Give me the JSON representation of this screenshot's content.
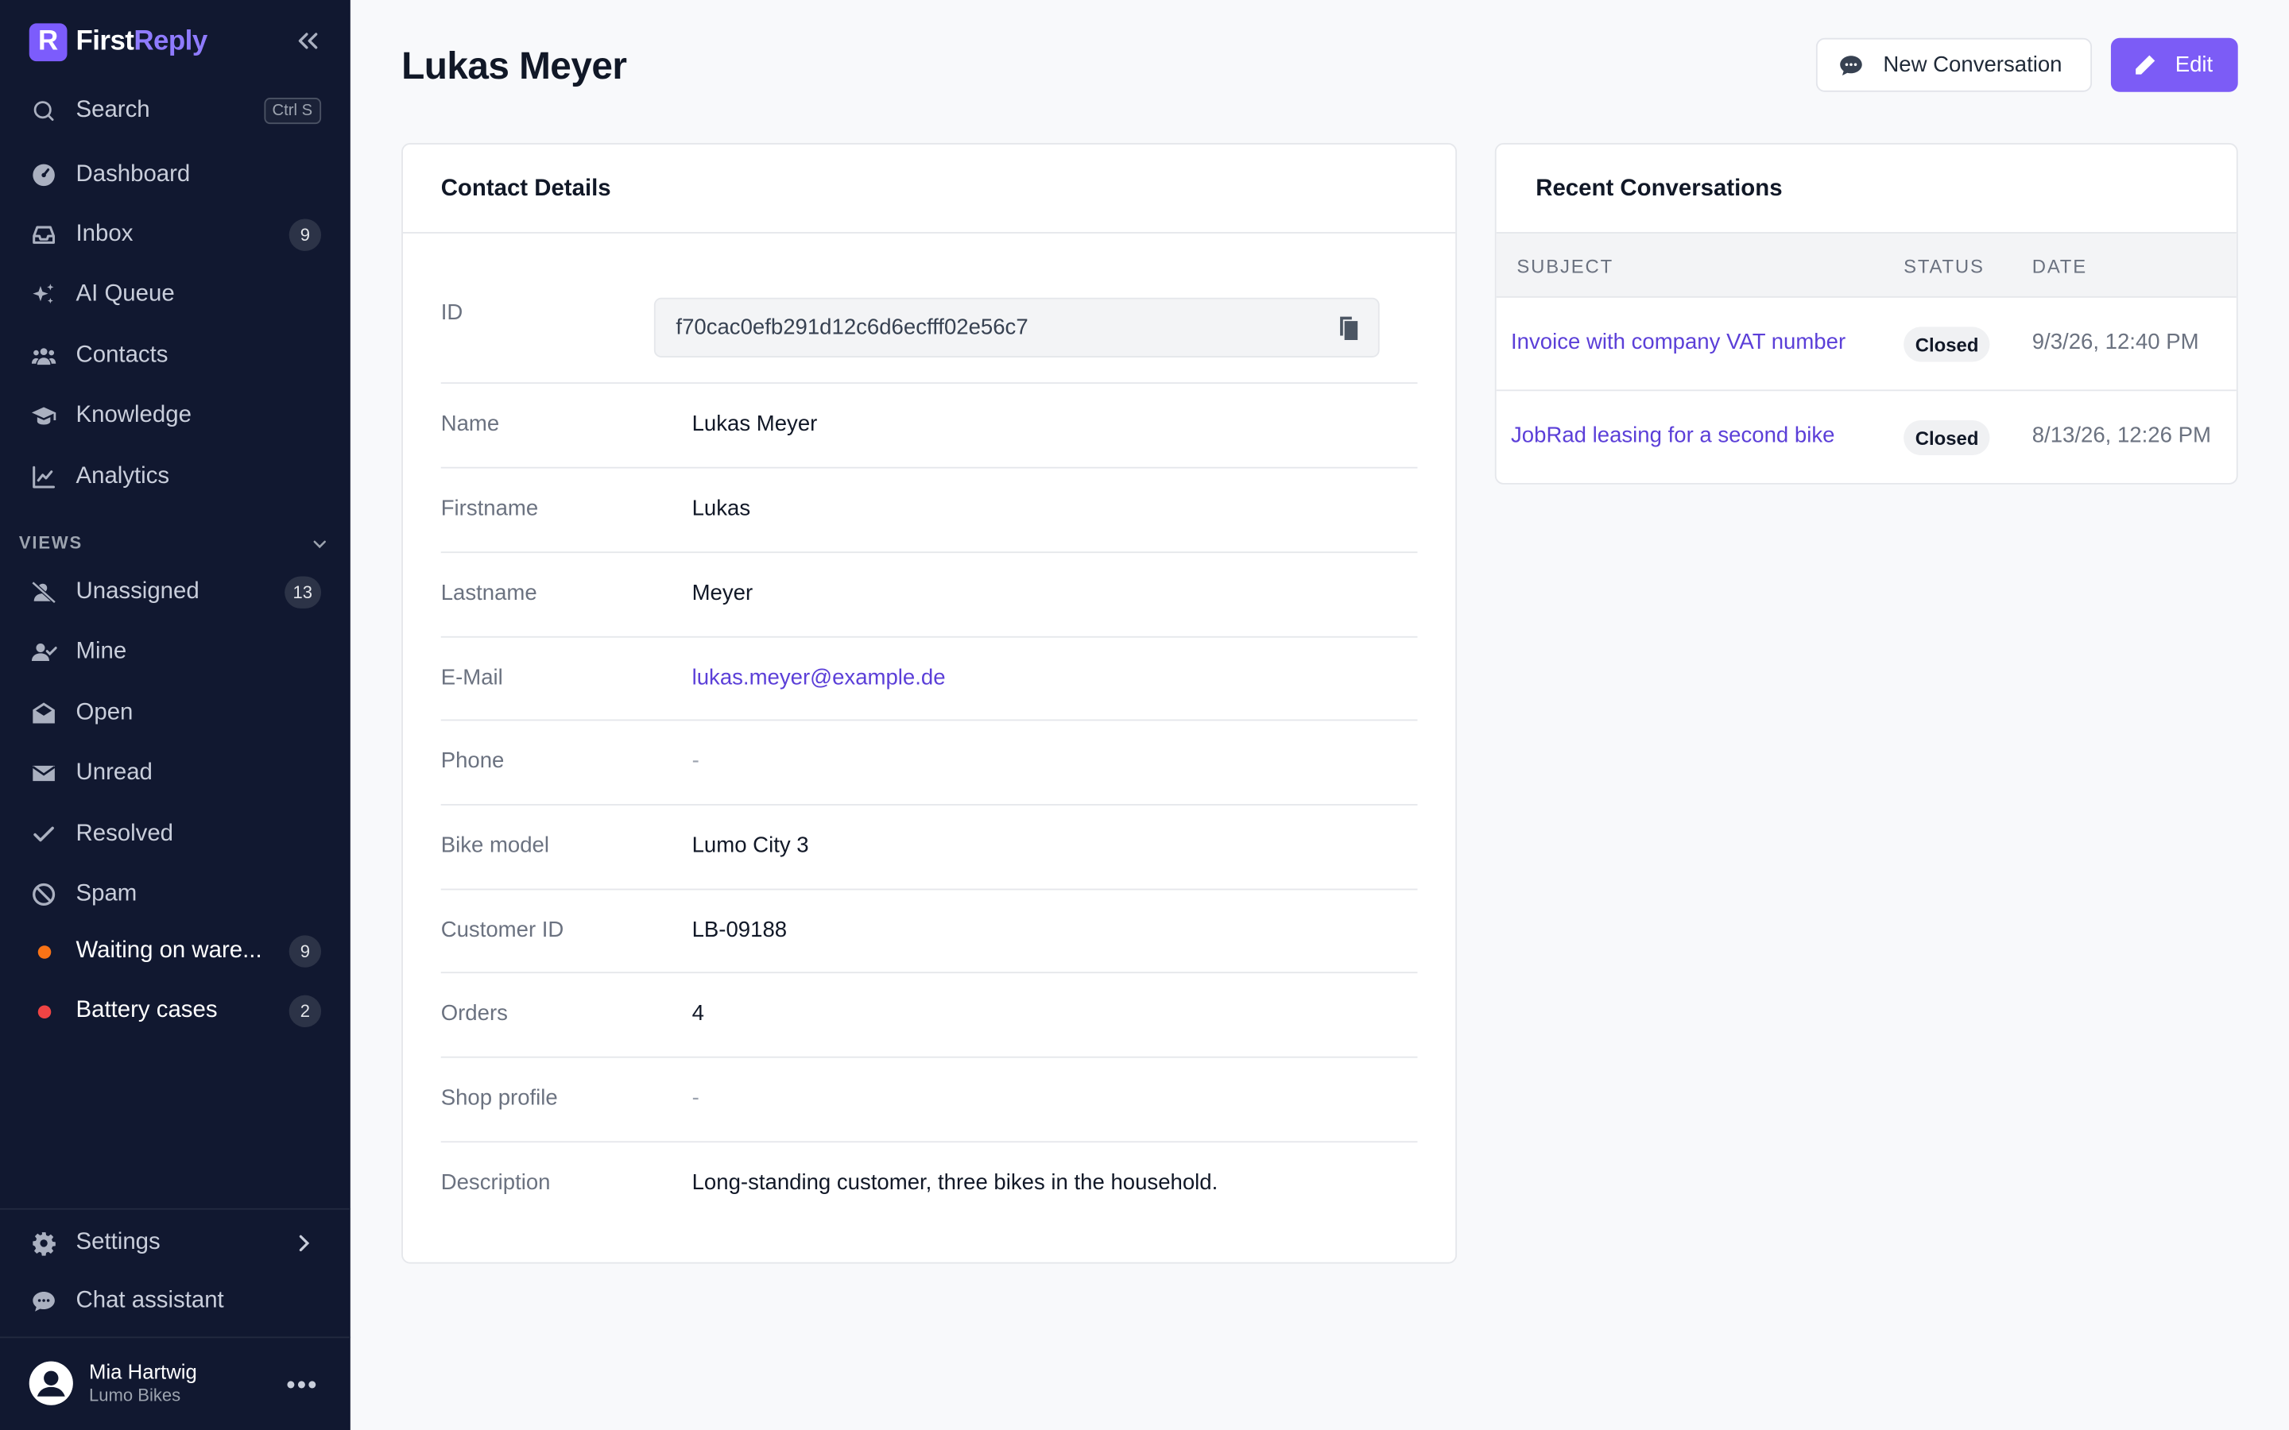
{
  "app": {
    "brand_prefix": "First",
    "brand_suffix": "Reply",
    "brand_letter": "R",
    "accent_color": "#7c5cf6",
    "sidebar_bg": "#111830"
  },
  "sidebar": {
    "search_label": "Search",
    "search_shortcut": "Ctrl S",
    "items": [
      {
        "label": "Dashboard",
        "icon": "dashboard-icon"
      },
      {
        "label": "Inbox",
        "icon": "inbox-icon",
        "badge": "9"
      },
      {
        "label": "AI Queue",
        "icon": "sparkles-icon"
      },
      {
        "label": "Contacts",
        "icon": "users-icon"
      },
      {
        "label": "Knowledge",
        "icon": "graduation-cap-icon"
      },
      {
        "label": "Analytics",
        "icon": "chart-line-icon"
      }
    ],
    "views_label": "VIEWS",
    "views": [
      {
        "label": "Unassigned",
        "icon": "user-slash-icon",
        "badge": "13"
      },
      {
        "label": "Mine",
        "icon": "user-check-icon"
      },
      {
        "label": "Open",
        "icon": "envelope-open-icon"
      },
      {
        "label": "Unread",
        "icon": "envelope-icon"
      },
      {
        "label": "Resolved",
        "icon": "check-icon"
      },
      {
        "label": "Spam",
        "icon": "ban-icon"
      },
      {
        "label": "Waiting on ware...",
        "dot_color": "#f97316",
        "badge": "9"
      },
      {
        "label": "Battery cases",
        "dot_color": "#ef4444",
        "badge": "2"
      }
    ],
    "settings_label": "Settings",
    "chat_assistant_label": "Chat assistant",
    "user": {
      "name": "Mia Hartwig",
      "org": "Lumo Bikes"
    }
  },
  "header": {
    "title": "Lukas Meyer",
    "new_conversation_label": "New Conversation",
    "edit_label": "Edit"
  },
  "contact_details": {
    "title": "Contact Details",
    "id_label": "ID",
    "id_value": "f70cac0efb291d12c6d6ecfff02e56c7",
    "fields": [
      {
        "label": "Name",
        "value": "Lukas Meyer"
      },
      {
        "label": "Firstname",
        "value": "Lukas"
      },
      {
        "label": "Lastname",
        "value": "Meyer"
      },
      {
        "label": "E-Mail",
        "value": "lukas.meyer@example.de"
      },
      {
        "label": "Phone",
        "value": "-"
      },
      {
        "label": "Bike model",
        "value": "Lumo City 3"
      },
      {
        "label": "Customer ID",
        "value": "LB-09188"
      },
      {
        "label": "Orders",
        "value": "4"
      },
      {
        "label": "Shop profile",
        "value": "-"
      },
      {
        "label": "Description",
        "value": "Long-standing customer, three bikes in the household."
      }
    ]
  },
  "recent_conversations": {
    "title": "Recent Conversations",
    "columns": [
      "SUBJECT",
      "STATUS",
      "DATE"
    ],
    "rows": [
      {
        "subject": "Invoice with company VAT number",
        "status": "Closed",
        "date": "9/3/26, 12:40 PM"
      },
      {
        "subject": "JobRad leasing for a second bike",
        "status": "Closed",
        "date": "8/13/26, 12:26 PM"
      }
    ]
  }
}
